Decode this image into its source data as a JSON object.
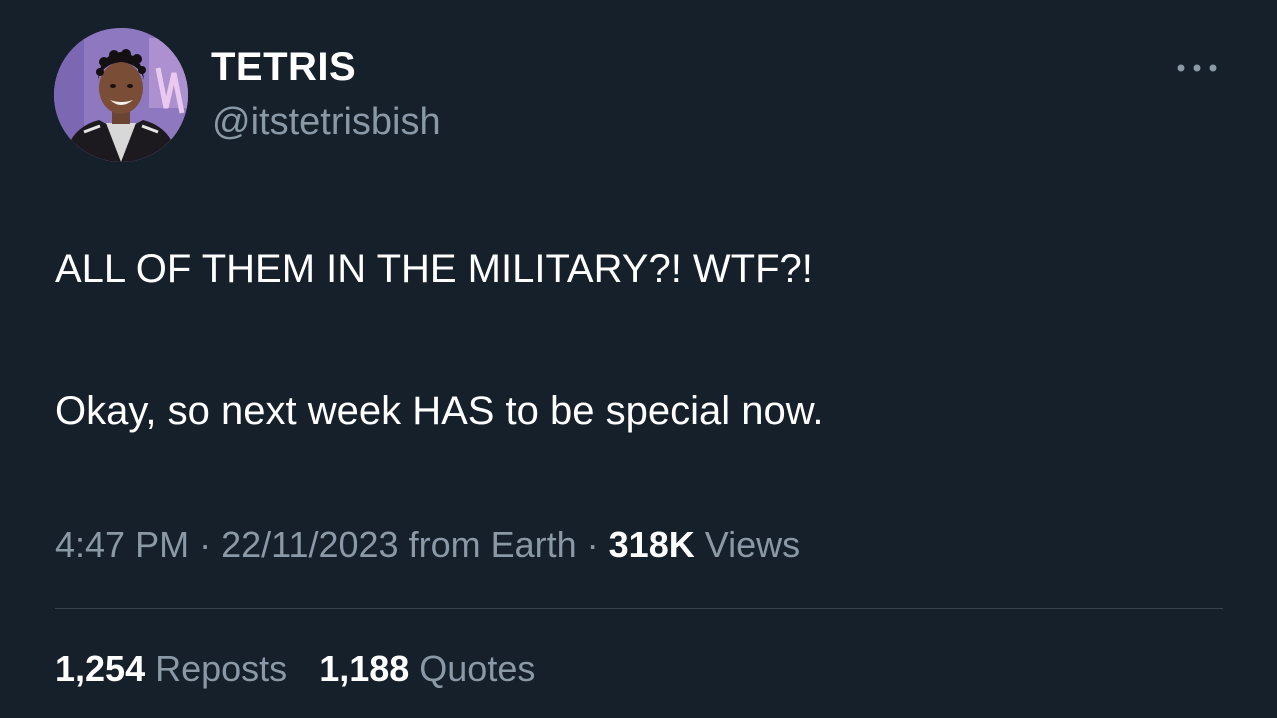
{
  "author": {
    "display_name": "TETRIS",
    "handle": "@itstetrisbish"
  },
  "tweet": {
    "lines": [
      "ALL OF THEM IN THE MILITARY?! WTF?!",
      "Okay, so next week HAS to be special now."
    ]
  },
  "meta": {
    "time": "4:47 PM",
    "separator": "·",
    "date": "22/11/2023",
    "source": "from Earth",
    "views_count": "318K",
    "views_label": "Views"
  },
  "stats": {
    "reposts_count": "1,254",
    "reposts_label": "Reposts",
    "quotes_count": "1,188",
    "quotes_label": "Quotes"
  },
  "icons": {
    "more": "more-horizontal-icon"
  },
  "colors": {
    "background": "#15202b",
    "primary_text": "#ffffff",
    "secondary_text": "#8b98a5",
    "divider": "#38444d"
  }
}
